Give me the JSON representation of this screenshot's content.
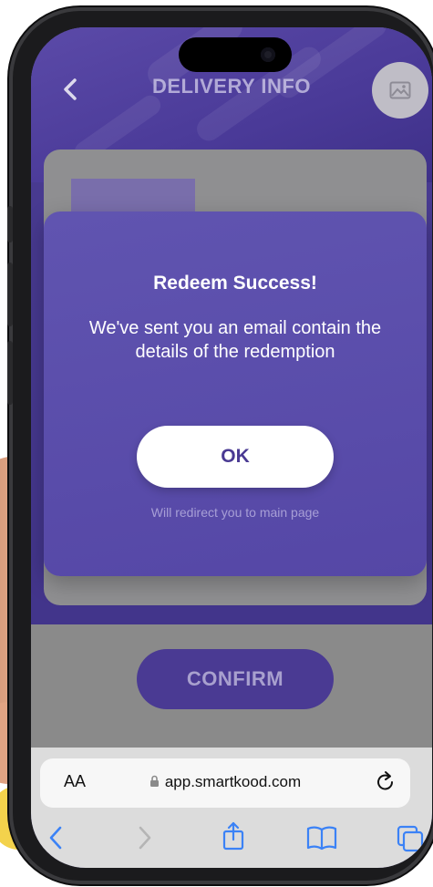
{
  "app": {
    "page_title": "DELIVERY INFO",
    "confirm_label": "CONFIRM"
  },
  "modal": {
    "title": "Redeem Success!",
    "message": "We've sent you an email contain the details of the redemption",
    "ok_label": "OK",
    "redirect_note": "Will redirect you to main page"
  },
  "browser": {
    "text_size_label": "AA",
    "url": "app.smartkood.com"
  },
  "icons": {
    "back": "chevron-left-icon",
    "avatar": "image-placeholder-icon",
    "lock": "lock-icon",
    "reload": "reload-icon",
    "toolbar": [
      "back-arrow-icon",
      "forward-arrow-icon",
      "share-icon",
      "bookmarks-icon",
      "tabs-icon"
    ]
  },
  "colors": {
    "primary": "#4a3a93",
    "modal": "#5a4cab",
    "safari_accent": "#3b82f6"
  }
}
